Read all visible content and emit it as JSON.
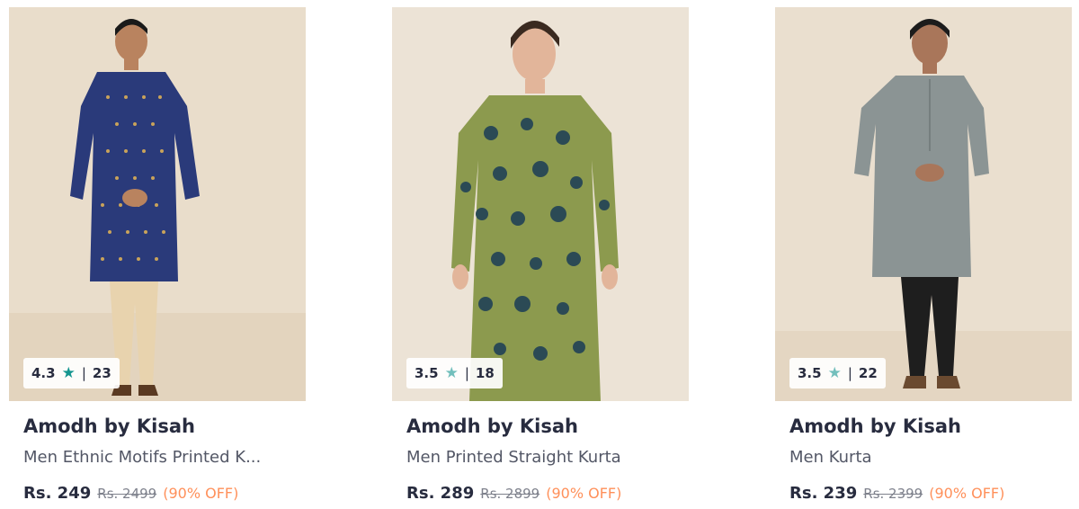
{
  "products": [
    {
      "image_alt": "Navy blue kurta",
      "rating": "4.3",
      "rating_count": "23",
      "brand": "Amodh by Kisah",
      "title": "Men Ethnic Motifs Printed K...",
      "price": "Rs. 249",
      "mrp": "Rs. 2499",
      "discount": "(90% OFF)",
      "colors": {
        "kurta": "#2a3a7a",
        "pattern": "#c9a35a",
        "bottom": "#e8d3ae",
        "bg": "#e9ddcb"
      }
    },
    {
      "image_alt": "Olive floral kurta",
      "rating": "3.5",
      "rating_count": "18",
      "brand": "Amodh by Kisah",
      "title": "Men Printed Straight Kurta",
      "price": "Rs. 289",
      "mrp": "Rs. 2899",
      "discount": "(90% OFF)",
      "colors": {
        "kurta": "#8c9a4e",
        "pattern": "#2b4a55",
        "bottom": "#1c1c1c",
        "bg": "#ece3d6"
      }
    },
    {
      "image_alt": "Grey kurta",
      "rating": "3.5",
      "rating_count": "22",
      "brand": "Amodh by Kisah",
      "title": "Men Kurta",
      "price": "Rs. 239",
      "mrp": "Rs. 2399",
      "discount": "(90% OFF)",
      "colors": {
        "kurta": "#8b9494",
        "pattern": "#9aa3a3",
        "bottom": "#1e1e1e",
        "bg": "#eadfcf"
      }
    }
  ],
  "icons": {
    "rating_star": "star-icon"
  }
}
